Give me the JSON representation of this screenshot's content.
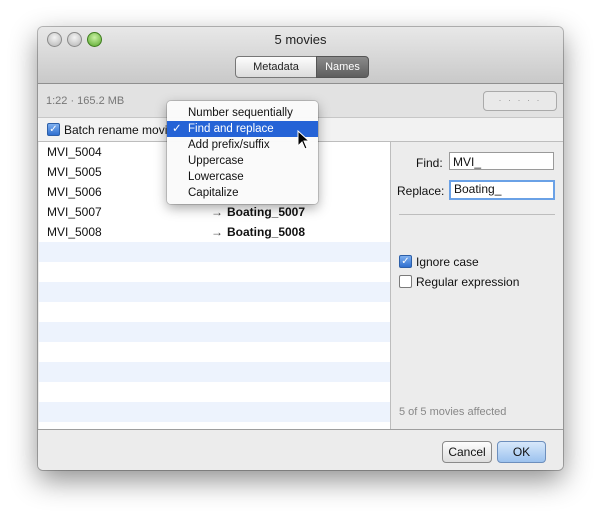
{
  "window": {
    "title": "5 movies"
  },
  "tabs": [
    {
      "label": "Metadata"
    },
    {
      "label": "Names"
    }
  ],
  "info": {
    "duration_size": "1:22 · 165.2 MB",
    "search_dots": "· · · · ·"
  },
  "batch": {
    "label": "Batch rename movi",
    "checked": true
  },
  "rows": [
    {
      "name": "MVI_5004",
      "arrow": "",
      "new_name": ""
    },
    {
      "name": "MVI_5005",
      "arrow": "",
      "new_name": ""
    },
    {
      "name": "MVI_5006",
      "arrow": "",
      "new_name": ""
    },
    {
      "name": "MVI_5007",
      "arrow": "→",
      "new_name": "Boating_5007"
    },
    {
      "name": "MVI_5008",
      "arrow": "→",
      "new_name": "Boating_5008"
    }
  ],
  "menu": {
    "items": [
      {
        "label": "Number sequentially",
        "check": ""
      },
      {
        "label": "Find and replace",
        "check": "✓"
      },
      {
        "label": "Add prefix/suffix",
        "check": ""
      },
      {
        "label": "Uppercase",
        "check": ""
      },
      {
        "label": "Lowercase",
        "check": ""
      },
      {
        "label": "Capitalize",
        "check": ""
      }
    ]
  },
  "side": {
    "find_label": "Find:",
    "find_value": "MVI_",
    "replace_label": "Replace:",
    "replace_value": "Boating_",
    "ignore_case_label": "Ignore case",
    "ignore_case_checked": true,
    "regex_label": "Regular expression",
    "regex_checked": false,
    "affected": "5 of 5 movies affected"
  },
  "buttons": {
    "cancel": "Cancel",
    "ok": "OK"
  },
  "colors": {
    "selection": "#2563d6",
    "stripe": "#edf3fd",
    "ok_button": "#9cc2ee"
  }
}
